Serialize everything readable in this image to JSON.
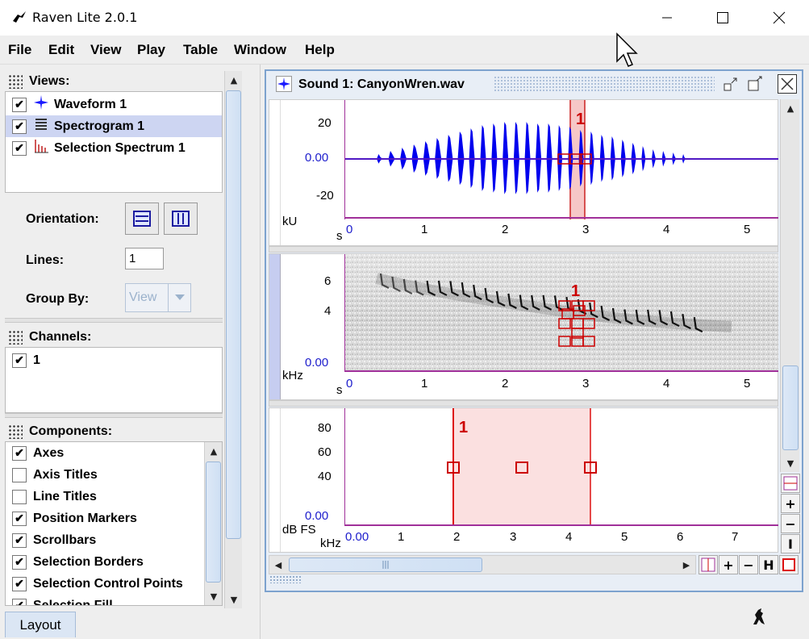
{
  "window": {
    "title": "Raven Lite 2.0.1",
    "controls": [
      "minimize-icon",
      "maximize-icon",
      "close-icon"
    ]
  },
  "menubar": {
    "items": [
      "File",
      "Edit",
      "View",
      "Play",
      "Table",
      "Window",
      "Help"
    ]
  },
  "views": {
    "header": "Views:",
    "items": [
      {
        "label": "Waveform 1",
        "checked": true,
        "icon": "waveform-view-icon"
      },
      {
        "label": "Spectrogram 1",
        "checked": true,
        "icon": "spectrogram-view-icon",
        "selected": true
      },
      {
        "label": "Selection Spectrum 1",
        "checked": true,
        "icon": "spectrum-view-icon"
      }
    ],
    "orientation_label": "Orientation:",
    "lines_label": "Lines:",
    "lines_value": "1",
    "groupby_label": "Group By:",
    "groupby_value": "View"
  },
  "channels": {
    "header": "Channels:",
    "items": [
      {
        "label": "1",
        "checked": true
      }
    ]
  },
  "components": {
    "header": "Components:",
    "items": [
      {
        "label": "Axes",
        "checked": true
      },
      {
        "label": "Axis Titles",
        "checked": false
      },
      {
        "label": "Line Titles",
        "checked": false
      },
      {
        "label": "Position Markers",
        "checked": true
      },
      {
        "label": "Scrollbars",
        "checked": true
      },
      {
        "label": "Selection Borders",
        "checked": true
      },
      {
        "label": "Selection Control Points",
        "checked": true
      },
      {
        "label": "Selection Fill",
        "checked": true
      }
    ]
  },
  "layout_tab": "Layout",
  "document": {
    "title": "Sound 1: CanyonWren.wav",
    "selection_label": "1",
    "waveform": {
      "y_ticks": [
        "20",
        "0.00",
        "-20"
      ],
      "y_unit": "kU",
      "x_unit": "s",
      "x_ticks": [
        "0",
        "1",
        "2",
        "3",
        "4",
        "5"
      ]
    },
    "spectrogram": {
      "y_ticks": [
        "6",
        "4",
        "0.00"
      ],
      "y_unit": "kHz",
      "x_unit": "s",
      "x_ticks": [
        "0",
        "1",
        "2",
        "3",
        "4",
        "5"
      ]
    },
    "spectrum": {
      "y_ticks": [
        "80",
        "60",
        "40",
        "0.00"
      ],
      "y_unit": "dB FS",
      "x_unit": "kHz",
      "x_ticks": [
        "0.00",
        "1",
        "2",
        "3",
        "4",
        "5",
        "6",
        "7"
      ]
    },
    "toolbar_buttons": [
      "+",
      "−",
      "I",
      "+",
      "−",
      "H"
    ]
  },
  "colors": {
    "accent_blue": "#1a1aff",
    "selection_red": "#e00000",
    "selection_fill": "#fbe0e0",
    "frame_blue": "#7da2ce"
  }
}
